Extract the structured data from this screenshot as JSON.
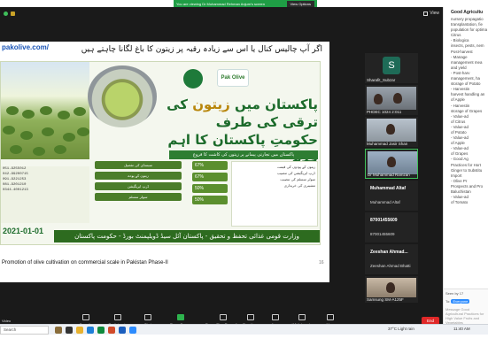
{
  "share_banner": {
    "text": "You are viewing Dr Muhammad Rehman Anjum's screen",
    "button": "View Options"
  },
  "zoom_top": {
    "view_label": "View"
  },
  "slide": {
    "url": "pakolive.com/",
    "urdu_top": "اگر آپ چالیس کنال یا اس سے زیادہ رقبہ پر زیتون کا باغ لگانا چاہتے ہیں",
    "logo_text": "Pak Olive",
    "headline_1": "پاکستان میں",
    "headline_olive": "زیتون",
    "headline_2": "کی ترقی کی طرف",
    "headline_3": "حکومتِ پاکستان کا اہم قدم",
    "sub_band": "پاکستان میں تجارتی پیمانے پر زیتون کی کاشت کا فروغ",
    "phones": [
      "051-9255012",
      "042-99200715",
      "091-9221253",
      "081-9201210",
      "0344-4001213"
    ],
    "mid_buttons": [
      "سبسڈی کی تفصیل",
      "زیتون کے پودے",
      "ڈرپ ایریگیشن",
      "سولر سسٹم"
    ],
    "percents": [
      "67%",
      "67%",
      "50%",
      "50%"
    ],
    "text_lines": [
      "زیتون کے پودوں کی قیمت",
      "ڈرپ ایریگیشن کی تنصیب",
      "سولر سسٹم کی تنصیب",
      "مشینری کی خریداری"
    ],
    "date": "2021-01-01",
    "footer": "وزارت قومی غذائی تحفظ و تحقیق - پاکستان آئل سیڈ ڈویلپمنٹ بورڈ - حکومت پاکستان",
    "caption": "Promotion of olive cultivation on commercial scale in Pakistan Phase-II",
    "slide_number": "16"
  },
  "tiles": [
    {
      "initial": "S",
      "name": "Sharafit_Subzar"
    },
    {
      "name": "PHDEC 1024 2:011"
    },
    {
      "name": "Muhammad Jasir Shan"
    },
    {
      "name": "Dr Muhammad Ramzan"
    },
    {
      "title": "Muhammad Altaf",
      "subtitle": "Muhammad Altaf"
    },
    {
      "title": "87001455609",
      "subtitle": "87001455609"
    },
    {
      "title": "Zeeshan Ahmad...",
      "subtitle": "Zeeshan Ahmad Bhatti"
    },
    {
      "name": "Samsung SM-A125F"
    }
  ],
  "chat": {
    "title": "Good Agricultu",
    "lines": [
      "nursery propagatio",
      "transplantation, fie",
      "population for optima",
      "Citrus",
      "-       Biologica",
      "insects, pests, nem",
      "Post-harvest",
      "-       Manage",
      "management mea",
      "and yield",
      "-       Post-harv",
      "management, ha",
      "storage of Potato",
      "-       Harvestin",
      "harvest handling an",
      "of Apple",
      "-       Harvestin",
      "storage of Grapes",
      "-       Value-ad",
      "of Citrus",
      "-       Value-ad",
      "of Potato",
      "-       Value-ad",
      "of Apple",
      "-       Value-ad",
      "of Grapes",
      "-       Good Ag",
      "Practices for Hort",
      "Ginger to Substitu",
      "Import",
      "-       Olive Pr",
      "Prospects and Pro",
      "Baluchistan",
      "-       Value-ad",
      "of Tomato"
    ],
    "seen": "Seen by 17",
    "to_label": "To:",
    "to_value": "Everyone",
    "input_placeholder": "Message Good Agricultural Practices for High Value Fruits and Vegetables"
  },
  "toolbar": {
    "mic_label": "Video",
    "items": [
      "Security",
      "Participants",
      "Chat",
      "Share Screen",
      "Pause/Stop Recording",
      "Reactions",
      "Apps",
      "Whiteboards",
      "More"
    ],
    "end": "End"
  },
  "taskbar": {
    "search": "Search",
    "weather": "37°C Light rain",
    "clock": "11:40 AM"
  },
  "colors": {
    "share_green": "#1f9e45",
    "zoom_bg": "#1a1a1a",
    "olive_green": "#1c6b2b",
    "end_red": "#e02828"
  }
}
